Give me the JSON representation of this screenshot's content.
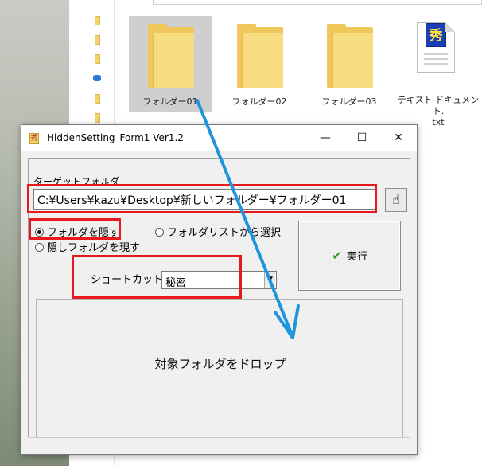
{
  "explorer": {
    "files": [
      {
        "label": "フォルダー01",
        "type": "folder",
        "selected": true
      },
      {
        "label": "フォルダー02",
        "type": "folder",
        "selected": false
      },
      {
        "label": "フォルダー03",
        "type": "folder",
        "selected": false
      },
      {
        "label": "テキスト ドキュメント.txt",
        "label_line1": "テキスト ドキュメント.",
        "label_line2": "txt",
        "type": "text",
        "badge": "秀"
      }
    ]
  },
  "window": {
    "title": "HiddenSetting_Form1 Ver1.2",
    "minimize": "—",
    "maximize": "☐",
    "close": "✕"
  },
  "form": {
    "target_label": "ターゲットフォルダ",
    "path_value": "C:¥Users¥kazu¥Desktop¥新しいフォルダー¥フォルダー01",
    "pointer_icon": "☝",
    "radio_hide": "フォルダを隠す",
    "radio_show": "隠しフォルダを現す",
    "radio_list": "フォルダリストから選択",
    "execute_label": "実行",
    "execute_check": "✔",
    "shortcut_label": "ショートカット名",
    "shortcut_value": "秘密",
    "drop_text": "対象フォルダをドロップ"
  },
  "annotation": {
    "color": "#e5191e",
    "arrow_color": "#1e96dc"
  }
}
